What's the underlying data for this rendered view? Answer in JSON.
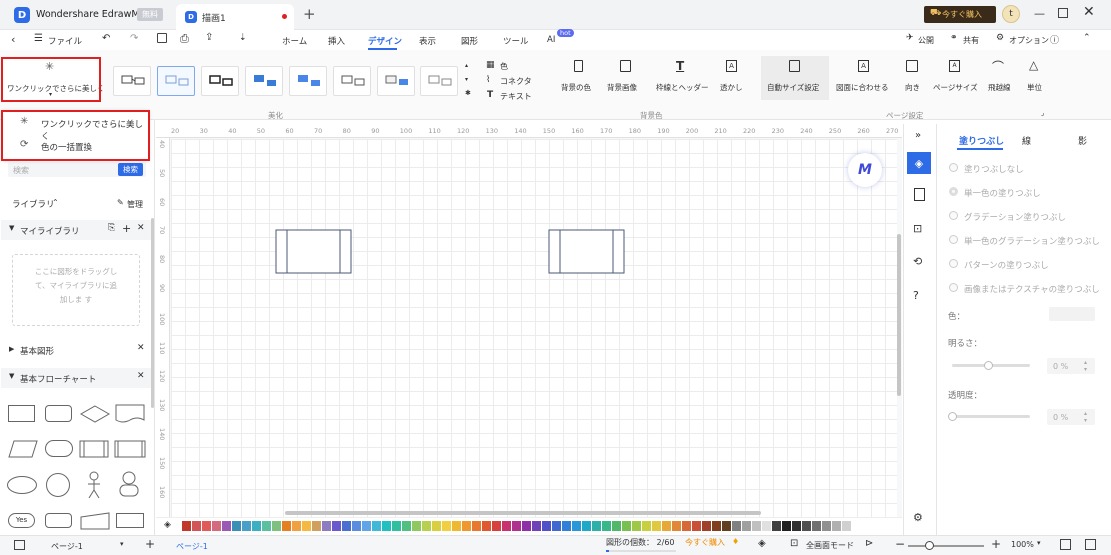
{
  "app": {
    "title": "Wondershare EdrawMax",
    "badge": "無料",
    "doc_tab": "描画1",
    "buy_label": "今すぐ購入",
    "avatar": "t"
  },
  "menu": {
    "file": "ファイル",
    "tabs": [
      "ホーム",
      "挿入",
      "デザイン",
      "表示",
      "図形",
      "ツール",
      "AI"
    ],
    "active_tab": "デザイン",
    "ai_badge": "hot",
    "publish": "公開",
    "share": "共有",
    "options": "オプション"
  },
  "ribbon": {
    "beautify_label": "ワンクリックでさらに美しく",
    "group_beautify": "美化",
    "color_label": "色",
    "connector_label": "コネクタ",
    "text_label": "テキスト",
    "bg_color": "背景の色",
    "bg_image": "背景画像",
    "borders_headers": "枠線とヘッダー",
    "watermark": "透かし",
    "group_background": "背景色",
    "auto_size": "自動サイズ設定",
    "fit_to_drawing": "図面に合わせる",
    "orientation": "向き",
    "page_size": "ページサイズ",
    "jump_line": "飛越線",
    "units": "単位",
    "group_page_setup": "ページ設定"
  },
  "dropdown": {
    "item1": "ワンクリックでさらに美しく",
    "item2": "色の一括置換"
  },
  "left": {
    "search_placeholder": "検索",
    "search_btn": "検索",
    "library": "ライブラリ",
    "manage": "管理",
    "my_library": "マイライブラリ",
    "my_library_hint": "ここに図形をドラッグして、マイライブラリに追加しま す",
    "basic_shapes": "基本図形",
    "basic_flowchart": "基本フローチャート",
    "yes_label": "Yes"
  },
  "ruler": {
    "top": [
      "20",
      "30",
      "40",
      "50",
      "60",
      "70",
      "80",
      "90",
      "100",
      "110",
      "120",
      "130",
      "140",
      "150",
      "160",
      "170",
      "180",
      "190",
      "200",
      "210",
      "220",
      "230",
      "240",
      "250",
      "260",
      "270"
    ],
    "left": [
      "40",
      "50",
      "60",
      "70",
      "80",
      "90",
      "100",
      "110",
      "120",
      "130",
      "140",
      "150",
      "160"
    ]
  },
  "right": {
    "tabs": [
      "塗りつぶし",
      "線",
      "影"
    ],
    "active_tab": "塗りつぶし",
    "options": [
      "塗りつぶしなし",
      "単一色の塗りつぶし",
      "グラデーション塗りつぶし",
      "単一色のグラデーション塗りつぶし",
      "パターンの塗りつぶし",
      "画像またはテクスチャの塗りつぶし"
    ],
    "color_label": "色：",
    "brightness_label": "明るさ：",
    "brightness_value": "0 %",
    "transparency_label": "透明度：",
    "transparency_value": "0 %"
  },
  "status": {
    "page_selector": "ページ-1",
    "page_tab": "ページ-1",
    "shape_count": "図形の個数： 2/60",
    "buy": "今すぐ購入",
    "fullscreen": "全画面モード",
    "zoom": "100%"
  },
  "colors": {
    "accent": "#2e6be6",
    "highlight": "#e02020",
    "buy_orange": "#f08c00"
  }
}
